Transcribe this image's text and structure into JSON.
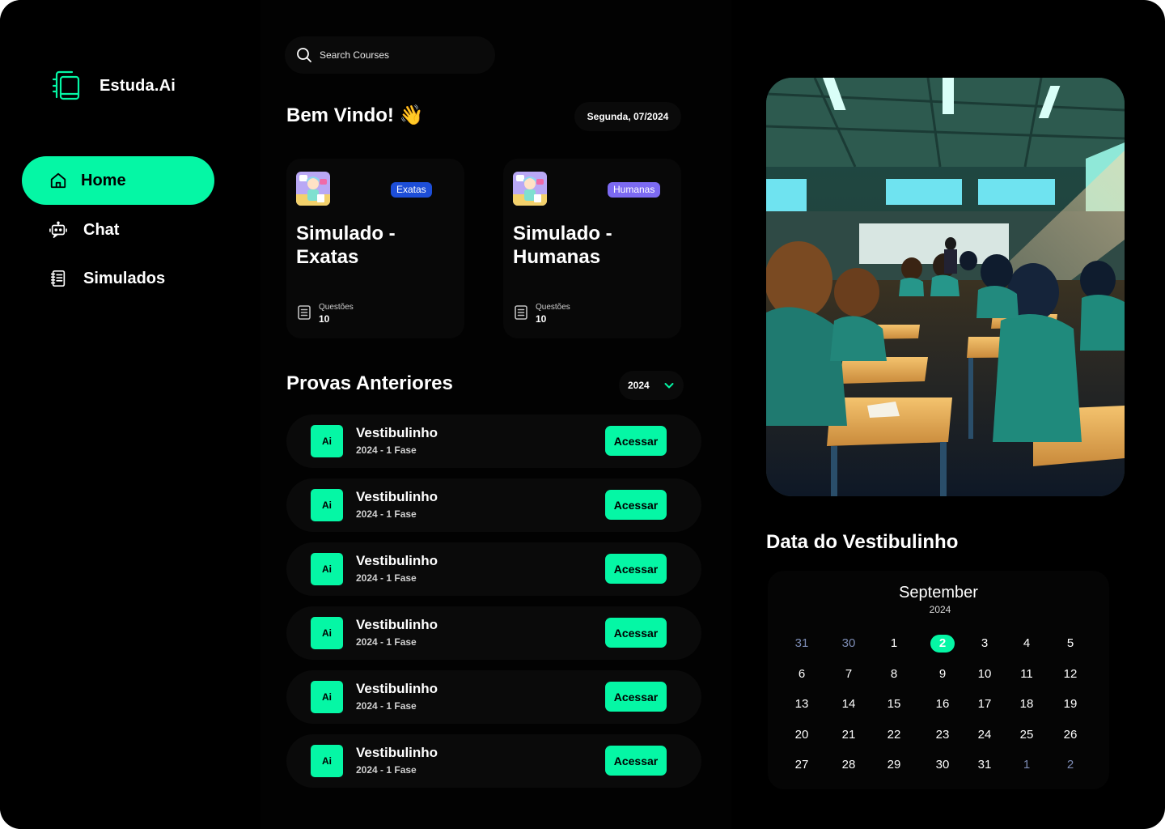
{
  "app": {
    "name": "Estuda.Ai",
    "accent_color": "#05f7a5"
  },
  "sidebar": {
    "items": [
      {
        "label": "Home",
        "icon": "home-icon",
        "active": true
      },
      {
        "label": "Chat",
        "icon": "chat-bot-icon",
        "active": false
      },
      {
        "label": "Simulados",
        "icon": "notebook-icon",
        "active": false
      }
    ]
  },
  "search": {
    "placeholder": "Search Courses"
  },
  "welcome": {
    "title": "Bem Vindo! 👋",
    "date": "Segunda, 07/2024"
  },
  "cards": [
    {
      "tag": "Exatas",
      "tag_color": "#1d4ed8",
      "title": "Simulado - Exatas",
      "questions_label": "Questões",
      "questions_value": "10"
    },
    {
      "tag": "Humanas",
      "tag_color": "#7c6af2",
      "title": "Simulado - Humanas",
      "questions_label": "Questões",
      "questions_value": "10"
    }
  ],
  "previous_exams": {
    "title": "Provas Anteriores",
    "year_selected": "2024",
    "items": [
      {
        "badge": "Ai",
        "title": "Vestibulinho",
        "subtitle": "2024 - 1 Fase",
        "action": "Acessar"
      },
      {
        "badge": "Ai",
        "title": "Vestibulinho",
        "subtitle": "2024 - 1 Fase",
        "action": "Acessar"
      },
      {
        "badge": "Ai",
        "title": "Vestibulinho",
        "subtitle": "2024 - 1 Fase",
        "action": "Acessar"
      },
      {
        "badge": "Ai",
        "title": "Vestibulinho",
        "subtitle": "2024 - 1 Fase",
        "action": "Acessar"
      },
      {
        "badge": "Ai",
        "title": "Vestibulinho",
        "subtitle": "2024 - 1 Fase",
        "action": "Acessar"
      },
      {
        "badge": "Ai",
        "title": "Vestibulinho",
        "subtitle": "2024 - 1 Fase",
        "action": "Acessar"
      }
    ]
  },
  "calendar": {
    "section_title": "Data do Vestibulinho",
    "month": "September",
    "year": "2024",
    "selected_day": "2",
    "weeks": [
      [
        "31",
        "30",
        "1",
        "2",
        "3",
        "4",
        "5"
      ],
      [
        "6",
        "7",
        "8",
        "9",
        "10",
        "11",
        "12"
      ],
      [
        "13",
        "14",
        "15",
        "16",
        "17",
        "18",
        "19"
      ],
      [
        "20",
        "21",
        "22",
        "23",
        "24",
        "25",
        "26"
      ],
      [
        "27",
        "28",
        "29",
        "30",
        "31",
        "1",
        "2"
      ]
    ]
  }
}
